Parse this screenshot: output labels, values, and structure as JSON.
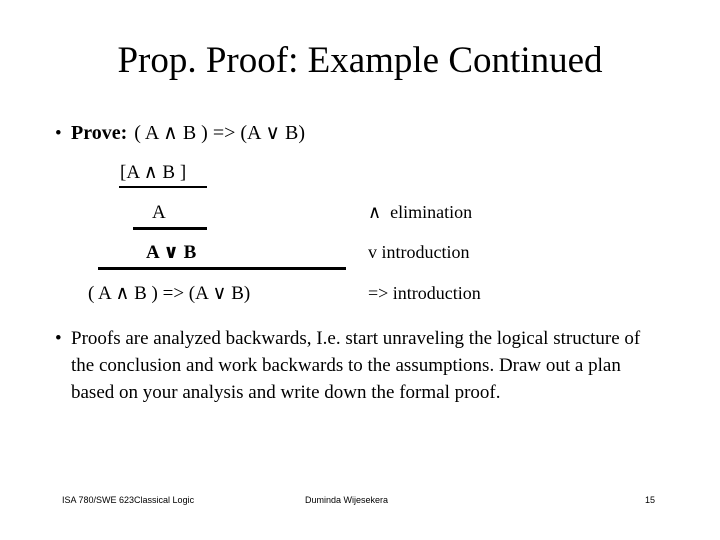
{
  "slide": {
    "title": "Prop. Proof: Example Continued",
    "bullet_glyph": "•"
  },
  "prove": {
    "label": "Prove:",
    "expression": "( A ∧ B ) => (A ∨ B)"
  },
  "proof": {
    "lines": [
      {
        "expression": "[A ∧ B ]",
        "rule": "",
        "has_bar": true
      },
      {
        "expression": "A",
        "rule": "∧  elimination",
        "has_bar": true
      },
      {
        "expression": "A ∨ B",
        "rule": "v introduction",
        "has_bar": true
      },
      {
        "expression": "( A ∧ B ) => (A ∨ B)",
        "rule": "=> introduction",
        "has_bar": false
      }
    ]
  },
  "paragraph": {
    "text": "Proofs are analyzed backwards, I.e. start unraveling the logical structure of the conclusion and work backwards to the assumptions. Draw out a plan based on your analysis and write down the formal proof."
  },
  "footer": {
    "left": "ISA 780/SWE 623Classical Logic",
    "center": "Duminda Wijesekera",
    "page_number": "15"
  },
  "colors": {
    "background": "#ffffff",
    "text": "#000000",
    "rule_bar": "#000000"
  }
}
